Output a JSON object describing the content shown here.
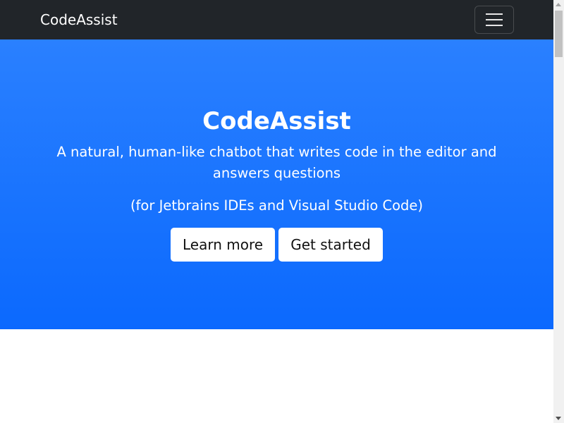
{
  "navbar": {
    "brand": "CodeAssist",
    "toggler_icon": "hamburger-menu-icon"
  },
  "hero": {
    "title": "CodeAssist",
    "subtitle": "A natural, human-like chatbot that writes code in the editor and answers questions",
    "ides_note": "(for Jetbrains IDEs and Visual Studio Code)",
    "buttons": {
      "learn_more": "Learn more",
      "get_started": "Get started"
    }
  },
  "colors": {
    "navbar_bg": "#212529",
    "hero_gradient_top": "#2a80ff",
    "hero_gradient_bottom": "#0b69fe",
    "button_bg": "#ffffff",
    "button_text": "#111111"
  }
}
